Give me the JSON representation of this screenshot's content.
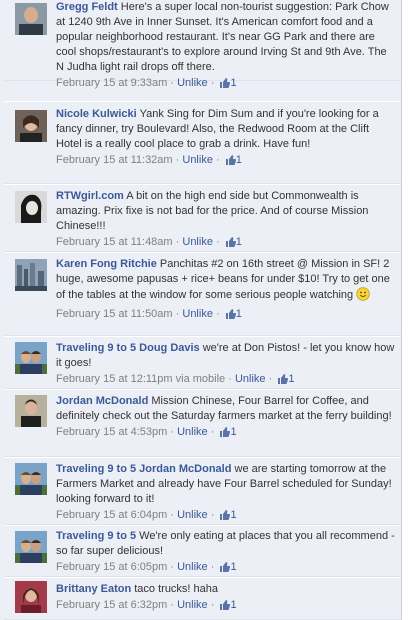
{
  "comments": [
    {
      "author": "Gregg Feldt",
      "text": "Here's a super local non-tourist suggestion: Park Chow at 1240 9th Ave in Inner Sunset. It's American comfort food and a popular neighborhood restaurant. It's near GG Park and there are cool shops/restaurant's to explore around Irving St and 9th Ave. The N Judha light rail drops off there.",
      "timestamp": "February 15 at 9:33am",
      "sep": " · ",
      "unlike": "Unlike",
      "likes": "1"
    },
    {
      "author": "Nicole Kulwicki",
      "text": "Yank Sing for Dim Sum and if you're looking for a fancy dinner, try Boulevard! Also, the Redwood Room at the Clift Hotel is a really cool place to grab a drink. Have fun!",
      "timestamp": "February 15 at 11:32am",
      "sep": " · ",
      "unlike": "Unlike",
      "likes": "1"
    },
    {
      "author": "RTWgirl.com",
      "text": "A bit on the high end side but Commonwealth is amazing. Prix fixe is not bad for the price. And of course Mission Chinese!!!",
      "timestamp": "February 15 at 11:48am",
      "sep": " · ",
      "unlike": "Unlike",
      "likes": "1"
    },
    {
      "author": "Karen Fong Ritchie",
      "text": "Panchitas #2 on 16th street @ Mission in SF! 2 huge, awesome papusas + rice+ beans for under $10! Try to get one of the tables at the window for some serious people watching",
      "timestamp": "February 15 at 11:50am",
      "sep": " · ",
      "unlike": "Unlike",
      "likes": "1"
    },
    {
      "author": "Traveling 9 to 5",
      "mention": "Doug Davis",
      "text": "we're at Don Pistos! - let you know how it goes!",
      "timestamp": "February 15 at 12:11pm",
      "via": "via mobile",
      "sep": " · ",
      "unlike": "Unlike",
      "likes": "1"
    },
    {
      "author": "Jordan McDonald",
      "text": "Mission Chinese, Four Barrel for Coffee, and definitely check out the Saturday farmers market at the ferry building!",
      "timestamp": "February 15 at 4:53pm",
      "sep": " · ",
      "unlike": "Unlike",
      "likes": "1"
    },
    {
      "author": "Traveling 9 to 5",
      "mention": "Jordan McDonald",
      "text": "we are starting tomorrow at the Farmers Market and already have Four Barrel scheduled for Sunday! looking forward to it!",
      "timestamp": "February 15 at 6:04pm",
      "sep": " · ",
      "unlike": "Unlike",
      "likes": "1"
    },
    {
      "author": "Traveling 9 to 5",
      "text": "We're only eating at places that you all recommend - so far super delicious!",
      "timestamp": "February 15 at 6:05pm",
      "sep": " · ",
      "unlike": "Unlike",
      "likes": "1"
    },
    {
      "author": "Brittany Eaton",
      "text": "taco trucks! haha",
      "timestamp": "February 15 at 6:32pm",
      "sep": " · ",
      "unlike": "Unlike",
      "likes": "1"
    }
  ],
  "icons": {
    "like": "thumbs-up-icon",
    "smiley": "smiley-emoticon-icon"
  },
  "colors": {
    "link": "#3b5998",
    "background": "#eceff5",
    "meta": "#808080"
  }
}
